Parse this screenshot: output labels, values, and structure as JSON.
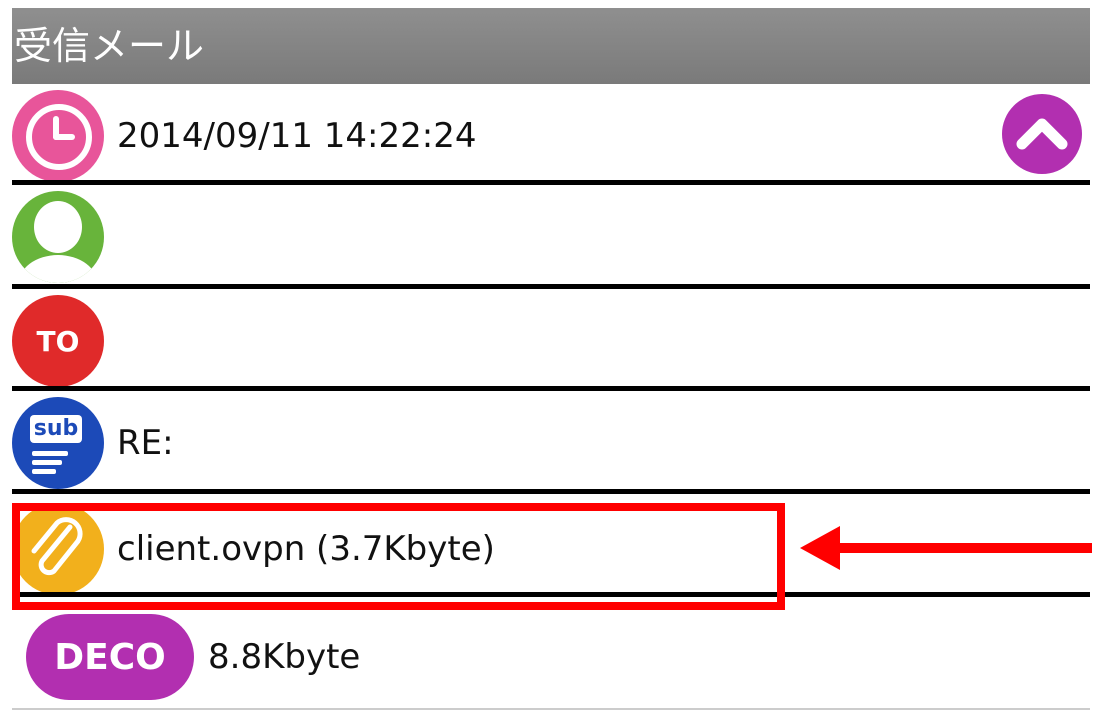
{
  "header": {
    "title": "受信メール"
  },
  "rows": {
    "date": {
      "icon": "clock-icon",
      "text": "2014/09/11 14:22:24"
    },
    "from": {
      "icon": "person-icon",
      "text": ""
    },
    "to": {
      "icon": "to-icon",
      "label": "TO",
      "text": ""
    },
    "subject": {
      "icon": "sub-icon",
      "label": "sub",
      "text": "RE:"
    },
    "attachment": {
      "icon": "paperclip-icon",
      "text": "client.ovpn (3.7Kbyte)"
    },
    "deco": {
      "label": "DECO",
      "size": "8.8Kbyte"
    }
  },
  "colors": {
    "header": "#878787",
    "clock": "#e8559a",
    "collapse": "#b22fb0",
    "person": "#68b43b",
    "to": "#e02a2a",
    "subject": "#1c4ab8",
    "attachment": "#f2b01c",
    "deco": "#b22fb0",
    "annotation": "#ff0000"
  }
}
